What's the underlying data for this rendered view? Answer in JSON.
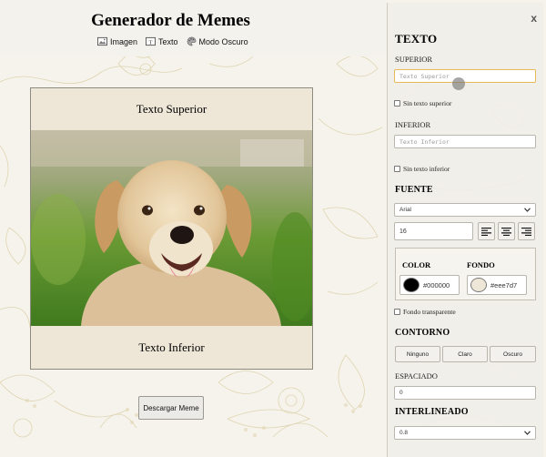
{
  "app": {
    "title": "Generador de Memes"
  },
  "nav": [
    {
      "label": "Imagen",
      "icon": "image-icon"
    },
    {
      "label": "Texto",
      "icon": "text-icon"
    },
    {
      "label": "Modo Oscuro",
      "icon": "palette-icon"
    }
  ],
  "meme": {
    "top_text": "Texto Superior",
    "bottom_text": "Texto Inferior",
    "background": "#eee7d7"
  },
  "download_label": "Descargar Meme",
  "panel": {
    "close": "x",
    "texto_title": "TEXTO",
    "superior_label": "SUPERIOR",
    "superior_placeholder": "Texto Superior",
    "sin_superior": "Sin texto superior",
    "inferior_label": "INFERIOR",
    "inferior_placeholder": "Texto Inferior",
    "sin_inferior": "Sin texto inferior",
    "fuente_title": "FUENTE",
    "font_family": "Arial",
    "font_size": "16",
    "color_label": "COLOR",
    "fondo_label": "FONDO",
    "color_value": "#000000",
    "fondo_value": "#eee7d7",
    "fondo_transparente": "Fondo transparente",
    "contorno_title": "CONTORNO",
    "contorno_options": [
      "Ninguno",
      "Claro",
      "Oscuro"
    ],
    "espaciado_label": "ESPACIADO",
    "espaciado_value": "0",
    "interlineado_title": "INTERLINEADO",
    "interlineado_value": "0.8"
  },
  "colors": {
    "accent_focus": "#e8b85a",
    "floral": "#d9c99a"
  }
}
